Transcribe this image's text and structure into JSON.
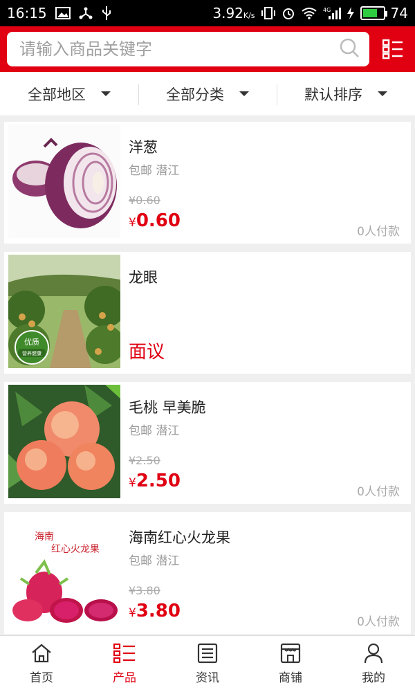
{
  "statusbar": {
    "time": "16:15",
    "speed": "3.92",
    "speed_unit": "K/s",
    "net": "4G",
    "battery": "74"
  },
  "search": {
    "placeholder": "请输入商品关键字"
  },
  "filters": [
    {
      "label": "全部地区"
    },
    {
      "label": "全部分类"
    },
    {
      "label": "默认排序"
    }
  ],
  "products": [
    {
      "name": "洋葱",
      "shipping": "包邮",
      "location": "潜江",
      "original_price": "¥0.60",
      "currency": "¥",
      "price": "0.60",
      "paid": "0人付款"
    },
    {
      "name": "龙眼",
      "negotiable": "面议"
    },
    {
      "name": "毛桃 早美脆",
      "shipping": "包邮",
      "location": "潜江",
      "original_price": "¥2.50",
      "currency": "¥",
      "price": "2.50",
      "paid": "0人付款"
    },
    {
      "name": "海南红心火龙果",
      "shipping": "包邮",
      "location": "潜江",
      "original_price": "¥3.80",
      "currency": "¥",
      "price": "3.80",
      "paid": "0人付款",
      "image_text_1": "海南",
      "image_text_2": "红心火龙果"
    }
  ],
  "thumb_badges": {
    "longan_1": "优质",
    "longan_2": "营养健康"
  },
  "bottomnav": [
    {
      "label": "首页",
      "icon": "home-icon"
    },
    {
      "label": "产品",
      "icon": "grid-list-icon",
      "active": true
    },
    {
      "label": "资讯",
      "icon": "news-icon"
    },
    {
      "label": "商铺",
      "icon": "shop-icon"
    },
    {
      "label": "我的",
      "icon": "user-icon"
    }
  ],
  "colors": {
    "brand": "#e00012",
    "text": "#333333",
    "muted": "#999999"
  }
}
